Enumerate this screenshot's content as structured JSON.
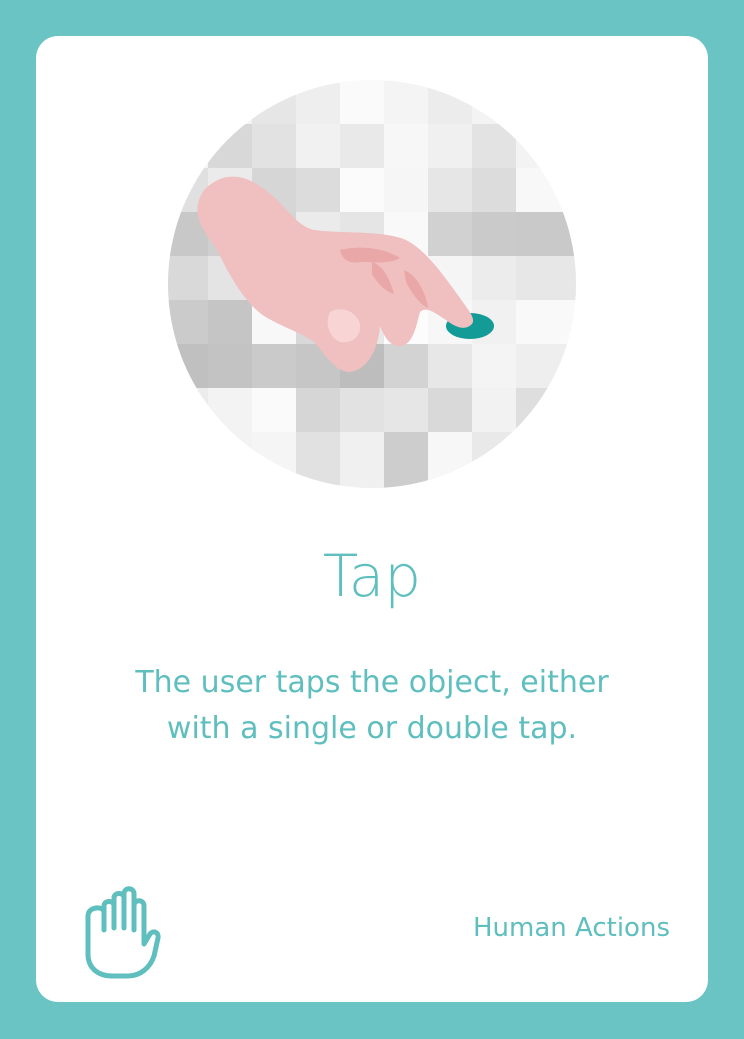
{
  "card": {
    "title": "Tap",
    "description_line1": "The user taps the object, either",
    "description_line2": "with a single or double tap.",
    "category": "Human Actions",
    "illustration_icon": "hand-tapping-surface",
    "footer_icon": "pointing-hand-icon"
  },
  "colors": {
    "accent": "#6ac4c4",
    "text": "#5fbebe",
    "tap_target": "#139b98",
    "skin": "#f0bfbf"
  }
}
